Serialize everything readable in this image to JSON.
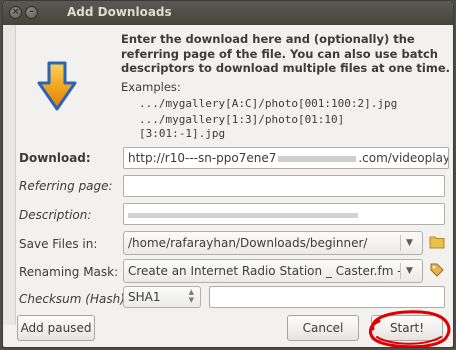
{
  "window": {
    "title": "Add Downloads",
    "close_glyph": "×",
    "minimize_glyph": "–"
  },
  "info": {
    "description": "Enter the download here and (optionally) the referring page of the file. You can also use batch descriptors to download multiple files at one time.",
    "examples_label": "Examples:",
    "examples": [
      ".../mygallery[A:C]/photo[001:100:2].jpg",
      ".../mygallery[1:3]/photo[01:10]",
      "[3:01:-1].jpg"
    ]
  },
  "form": {
    "download": {
      "label": "Download:",
      "value": "http://r10---sn-ppo7ene7",
      "value_tail": ".com/videoplayback?"
    },
    "referring_page": {
      "label": "Referring page:",
      "value": ""
    },
    "description": {
      "label": "Description:",
      "value": ""
    },
    "save_files_in": {
      "label": "Save Files in:",
      "value": "/home/rafarayhan/Downloads/beginner/"
    },
    "renaming_mask": {
      "label": "Renaming Mask:",
      "value": "Create an Internet Radio Station _ Caster.fm - Yo"
    },
    "checksum": {
      "label": "Checksum (Hash):",
      "algorithm": "SHA1",
      "value": ""
    }
  },
  "buttons": {
    "add_paused": "Add paused",
    "cancel": "Cancel",
    "start": "Start!"
  },
  "icons": {
    "arrow": "download-arrow-icon",
    "folder": "folder-icon",
    "tag": "tag-icon"
  },
  "colors": {
    "arrow_top": "#f7c03a",
    "arrow_bottom": "#2b63b5",
    "annotation_red": "#e00000"
  }
}
